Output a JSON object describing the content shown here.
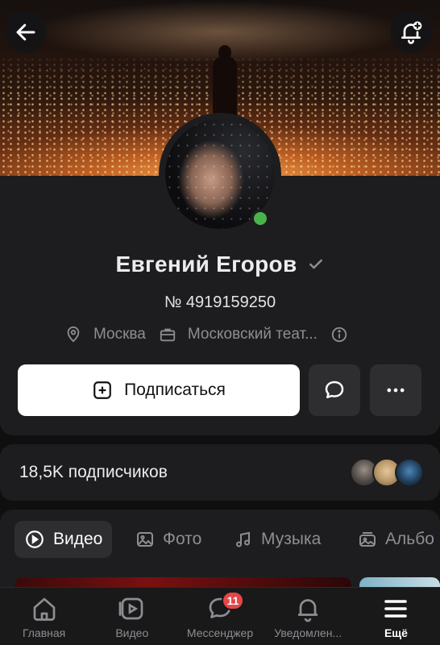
{
  "header": {
    "back_icon": "arrow-left-icon",
    "bell_icon": "bell-plus-icon"
  },
  "profile": {
    "name": "Евгений Егоров",
    "id_text": "№ 4919159250",
    "location": "Москва",
    "work": "Московский теат...",
    "online": true,
    "colors": {
      "online": "#4bb34b"
    }
  },
  "actions": {
    "subscribe_label": "Подписаться"
  },
  "subscribers": {
    "text": "18,5K подписчиков"
  },
  "tabs": [
    {
      "label": "Видео",
      "icon": "play-icon",
      "active": true
    },
    {
      "label": "Фото",
      "icon": "image-icon",
      "active": false
    },
    {
      "label": "Музыка",
      "icon": "music-note-icon",
      "active": false
    },
    {
      "label": "Альбо",
      "icon": "album-icon",
      "active": false
    }
  ],
  "nav": [
    {
      "label": "Главная",
      "icon": "home-icon"
    },
    {
      "label": "Видео",
      "icon": "video-icon"
    },
    {
      "label": "Мессенджер",
      "icon": "chat-icon",
      "badge": "11"
    },
    {
      "label": "Уведомлен...",
      "icon": "bell-icon"
    },
    {
      "label": "Ещё",
      "icon": "menu-icon",
      "active": true
    }
  ]
}
